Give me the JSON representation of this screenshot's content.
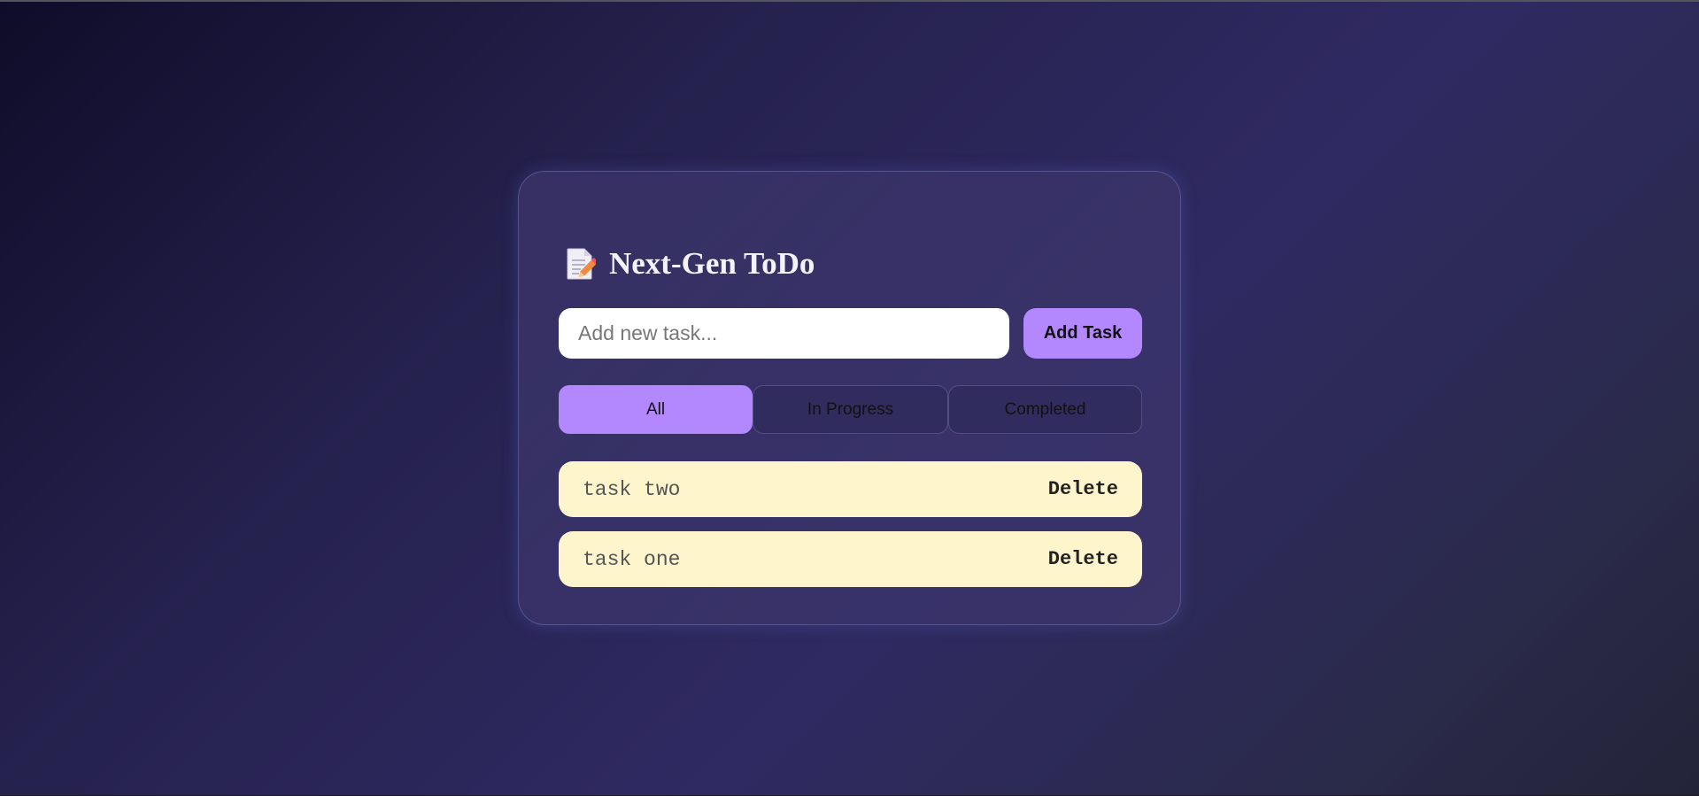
{
  "app": {
    "title": "Next-Gen ToDo",
    "title_icon": "memo-icon"
  },
  "new_task": {
    "placeholder": "Add new task...",
    "value": "",
    "add_button_label": "Add Task"
  },
  "filters": [
    {
      "label": "All",
      "active": true
    },
    {
      "label": "In Progress",
      "active": false
    },
    {
      "label": "Completed",
      "active": false
    }
  ],
  "tasks": [
    {
      "text": "task two",
      "delete_label": "Delete"
    },
    {
      "text": "task one",
      "delete_label": "Delete"
    }
  ],
  "colors": {
    "accent": "#b388ff",
    "task_background": "#fff5cc",
    "page_background_dark": "#0f0c29",
    "page_background_mid": "#2f2a62"
  }
}
